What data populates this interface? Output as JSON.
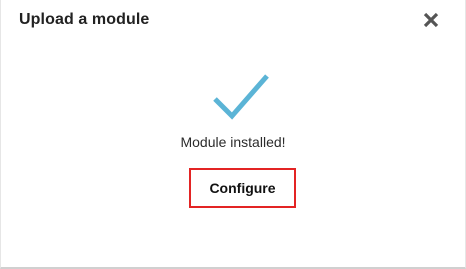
{
  "dialog": {
    "title": "Upload a module",
    "close_icon": "close-icon"
  },
  "status": {
    "icon": "checkmark-icon",
    "message": "Module installed!",
    "accent_color": "#5bb4d6"
  },
  "actions": {
    "configure_label": "Configure",
    "highlight_color": "#e32424"
  }
}
